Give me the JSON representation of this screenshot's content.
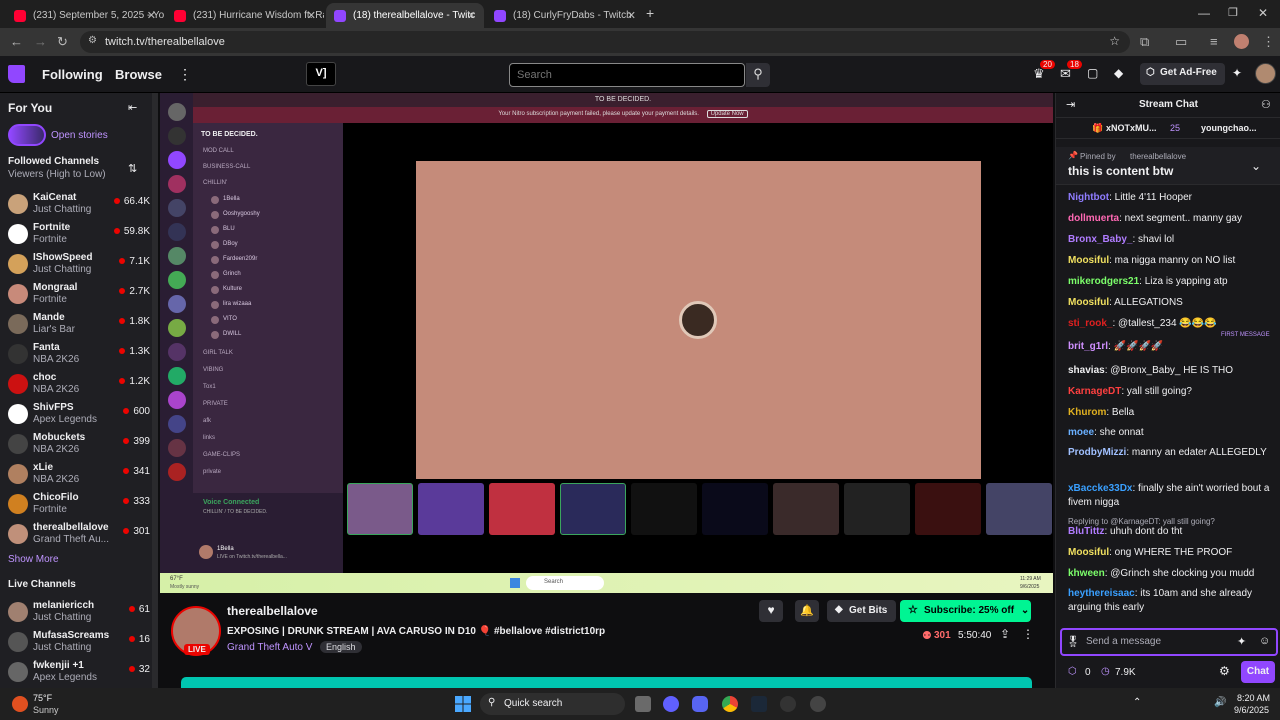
{
  "browser": {
    "tabs": [
      {
        "label": "(231) September 5, 2025 - YouT",
        "fav_color": "#ff0033",
        "active": false
      },
      {
        "label": "(231) Hurricane Wisdom ft. Rag",
        "fav_color": "#ff0033",
        "active": false
      },
      {
        "label": "(18) therealbellalove - Twitc",
        "fav_color": "#9146ff",
        "active": true
      },
      {
        "label": "(18) CurlyFryDabs - Twitch",
        "fav_color": "#9146ff",
        "active": false
      }
    ],
    "new_tab": "+",
    "url": "twitch.tv/therealbellalove"
  },
  "topnav": {
    "following": "Following",
    "browse": "Browse",
    "search_placeholder": "Search",
    "notif_badge_1": "20",
    "notif_badge_2": "18",
    "get_ad_free": "Get Ad-Free"
  },
  "sidebar": {
    "for_you": "For You",
    "open_stories": "Open stories",
    "followed_title": "Followed Channels",
    "sort": "Viewers (High to Low)",
    "followed": [
      {
        "name": "KaiCenat",
        "game": "Just Chatting",
        "viewers": "66.4K",
        "color": "#c9a27a"
      },
      {
        "name": "Fortnite",
        "game": "Fortnite",
        "viewers": "59.8K",
        "color": "#ffffff"
      },
      {
        "name": "IShowSpeed",
        "game": "Just Chatting",
        "viewers": "7.1K",
        "color": "#d4a15a"
      },
      {
        "name": "Mongraal",
        "game": "Fortnite",
        "viewers": "2.7K",
        "color": "#c88a7a"
      },
      {
        "name": "Mande",
        "game": "Liar's Bar",
        "viewers": "1.8K",
        "color": "#7a6a5a"
      },
      {
        "name": "Fanta",
        "game": "NBA 2K26",
        "viewers": "1.3K",
        "color": "#333333"
      },
      {
        "name": "choc",
        "game": "NBA 2K26",
        "viewers": "1.2K",
        "color": "#cc1111"
      },
      {
        "name": "ShivFPS",
        "game": "Apex Legends",
        "viewers": "600",
        "color": "#ffffff"
      },
      {
        "name": "Mobuckets",
        "game": "NBA 2K26",
        "viewers": "399",
        "color": "#444444"
      },
      {
        "name": "xLie",
        "game": "NBA 2K26",
        "viewers": "341",
        "color": "#b08060"
      },
      {
        "name": "ChicoFilo",
        "game": "Fortnite",
        "viewers": "333",
        "color": "#d08020"
      },
      {
        "name": "therealbellalove",
        "game": "Grand Theft Au...",
        "viewers": "301",
        "color": "#c0907a"
      }
    ],
    "show_more": "Show More",
    "live_title": "Live Channels",
    "live": [
      {
        "name": "melaniericch",
        "game": "Just Chatting",
        "viewers": "61",
        "color": "#a08070"
      },
      {
        "name": "MufasaScreams",
        "game": "Just Chatting",
        "viewers": "16",
        "color": "#555555"
      },
      {
        "name": "fwkenjii +1",
        "game": "Apex Legends",
        "viewers": "32",
        "color": "#666666"
      }
    ]
  },
  "player": {
    "discord_header": "TO BE DECIDED.",
    "nitro_warning": "Your Nitro subscription payment failed, please update your payment details.",
    "update_now": "Update Now",
    "server_name": "TO BE DECIDED.",
    "channels": [
      "MOD CALL",
      "BUSINESS-CALL",
      "CHILLIN'"
    ],
    "members": [
      "1Bella",
      "Ooshygooshy",
      "BLU",
      "DBoy",
      "Fardeen209r",
      "Grinch",
      "Kulture",
      "lira wizaaa",
      "VITO",
      "DWILL"
    ],
    "groups": [
      "GIRL TALK",
      "VIBING",
      "Tox1",
      "PRIVATE",
      "afk",
      "links",
      "GAME-CLIPS",
      "private"
    ],
    "voice_connected": "Voice Connected",
    "voice_sub": "CHILLIN' / TO BE DECIDED.",
    "user": "1Bella",
    "user_sub": "LIVE on Twitch.tv/therealbella...",
    "time": "11:29 AM",
    "date": "9/6/2025",
    "weather": "67°F",
    "weather_sub": "Mostly sunny",
    "search": "Search"
  },
  "stream": {
    "channel": "therealbellalove",
    "live_badge": "LIVE",
    "title": "EXPOSING | DRUNK STREAM | AVA CARUSO IN D10 🎈 #bellalove #district10rp",
    "game": "Grand Theft Auto V",
    "language": "English",
    "get_bits": "Get Bits",
    "subscribe": "Subscribe: 25% off",
    "viewers": "301",
    "uptime": "5:50:40"
  },
  "chat": {
    "title": "Stream Chat",
    "top_gifter": "xNOTxMU...",
    "top_count": "25",
    "top_user2": "youngchao...",
    "pinned_by_label": "Pinned by",
    "pinned_by_user": "therealbellalove",
    "pinned_text": "this is content btw",
    "first_message_tag": "FIRST MESSAGE",
    "messages": [
      {
        "user": "Nightbot",
        "color": "#8f7cff",
        "text": ": Little 4'11 Hooper"
      },
      {
        "user": "dollmuerta",
        "color": "#ff69b4",
        "text": ": next segment.. manny gay"
      },
      {
        "user": "Bronx_Baby_",
        "color": "#b07cff",
        "text": ": shavi lol"
      },
      {
        "user": "Moosiful",
        "color": "#f0e060",
        "text": ": ma nigga manny on NO list"
      },
      {
        "user": "mikerodgers21",
        "color": "#7cff6b",
        "text": ": Liza is yapping atp"
      },
      {
        "user": "Moosiful",
        "color": "#f0e060",
        "text": ": ALLEGATIONS"
      },
      {
        "user": "sti_rook_",
        "color": "#e02020",
        "text": ": @tallest_234 😂😂😂"
      },
      {
        "user": "brit_g1rl",
        "color": "#d090ff",
        "text": ": 🚀🚀🚀🚀"
      },
      {
        "user": "shavias",
        "color": "#efeff1",
        "text": ": @Bronx_Baby_ HE IS THO"
      },
      {
        "user": "KarnageDT",
        "color": "#ff4040",
        "text": ": yall still going?"
      },
      {
        "user": "Khurom",
        "color": "#e0b020",
        "text": ": Bella"
      },
      {
        "user": "moee",
        "color": "#6ab0ff",
        "text": ": she onnat"
      },
      {
        "user": "ProdbyMizzi",
        "color": "#a0c0ff",
        "text": ": manny an edater ALLEGEDLY"
      },
      {
        "user": "xBaccke33Dx",
        "color": "#3aa0ff",
        "text": ": finally she ain't worried bout a fivem nigga"
      },
      {
        "user": "BluTittz",
        "color": "#b07cff",
        "text": ": uhuh dont do tht"
      },
      {
        "user": "Moosiful",
        "color": "#f0e060",
        "text": ": ong WHERE THE PROOF"
      },
      {
        "user": "khween",
        "color": "#7cff6b",
        "text": ": @Grinch she clocking you mudd"
      },
      {
        "user": "heythereisaac",
        "color": "#3aa0ff",
        "text": ": its 10am and she already arguing this early"
      }
    ],
    "reply_note": "Replying to @KarnageDT: yall still going?",
    "input_placeholder": "Send a message",
    "points": "0",
    "bits": "7.9K",
    "chat_button": "Chat"
  },
  "taskbar": {
    "weather": "75°F",
    "weather_sub": "Sunny",
    "search": "Quick search",
    "time": "8:20 AM",
    "date": "9/6/2025"
  },
  "colors": {
    "twitch_purple": "#9147ff",
    "live_red": "#eb0400",
    "subscribe_green": "#00f593"
  }
}
